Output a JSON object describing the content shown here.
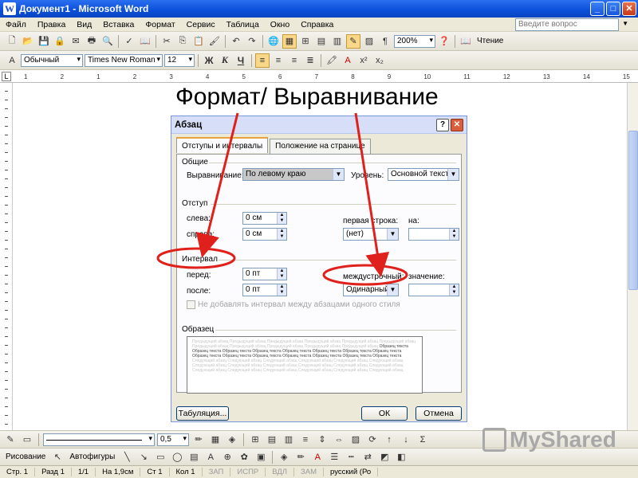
{
  "window": {
    "title": "Документ1 - Microsoft Word",
    "app_icon": "W"
  },
  "menu": {
    "items": [
      "Файл",
      "Правка",
      "Вид",
      "Вставка",
      "Формат",
      "Сервис",
      "Таблица",
      "Окно",
      "Справка"
    ],
    "help_placeholder": "Введите вопрос"
  },
  "standard_toolbar": {
    "zoom": "200%",
    "read_label": "Чтение"
  },
  "format_toolbar": {
    "style": "Обычный",
    "font": "Times New Roman",
    "size": "12",
    "bold": "Ж",
    "italic": "К",
    "underline": "Ч"
  },
  "ruler": {
    "marks": [
      "1",
      "2",
      "1",
      "2",
      "3",
      "4",
      "5",
      "6",
      "7",
      "8",
      "9",
      "10",
      "11",
      "12",
      "13",
      "14",
      "15"
    ]
  },
  "heading": "Формат/ Выравнивание",
  "dialog": {
    "title": "Абзац",
    "help_btn": "?",
    "close_btn": "✕",
    "tabs": [
      "Отступы и интервалы",
      "Положение на странице"
    ],
    "general": {
      "group": "Общие",
      "alignment_label": "Выравнивание:",
      "alignment_value": "По левому краю",
      "level_label": "Уровень:",
      "level_value": "Основной текст"
    },
    "indent": {
      "group": "Отступ",
      "left_label": "слева:",
      "left_value": "0 см",
      "right_label": "справа:",
      "right_value": "0 см",
      "first_line_label": "первая строка:",
      "first_line_value": "(нет)",
      "by_label": "на:",
      "by_value": ""
    },
    "spacing": {
      "group": "Интервал",
      "before_label": "перед:",
      "before_value": "0 пт",
      "after_label": "после:",
      "after_value": "0 пт",
      "line_label": "междустрочный:",
      "line_value": "Одинарный",
      "at_label": "значение:",
      "at_value": "",
      "no_space_label": "Не добавлять интервал между абзацами одного стиля"
    },
    "preview": {
      "group": "Образец",
      "prev_text": "Предыдущий абзац Предыдущий абзац Предыдущий абзац Предыдущий абзац Предыдущий абзац Предыдущий абзац Предыдущий абзац Предыдущий абзац Предыдущий абзац Предыдущий абзац Предыдущий абзац",
      "sample_text": "Образец текста Образец текста Образец текста Образец текста Образец текста Образец текста Образец текста Образец текста Образец текста Образец текста Образец текста Образец текста Образец текста Образец текста Образец текста",
      "next_text": "Следующий абзац Следующий абзац Следующий абзац Следующий абзац Следующий абзац Следующий абзац Следующий абзац Следующий абзац Следующий абзац Следующий абзац Следующий абзац Следующий абзац Следующий абзац Следующий абзац Следующий абзац Следующий абзац Следующий абзац Следующий абзац"
    },
    "tabs_btn": "Табуляция...",
    "ok": "ОК",
    "cancel": "Отмена"
  },
  "drawing_toolbar": {
    "draw_label": "Рисование",
    "autoshapes_label": "Автофигуры",
    "line_width": "0,5"
  },
  "status": {
    "page": "Стр. 1",
    "section": "Разд 1",
    "pages": "1/1",
    "at": "На 1,9см",
    "line": "Ст 1",
    "col": "Кол 1",
    "rec": "ЗАП",
    "trk": "ИСПР",
    "ext": "ВДЛ",
    "ovr": "ЗАМ",
    "lang": "русский (Ро"
  },
  "watermark": "MyShared",
  "colors": {
    "annotation": "#e0201b",
    "title_bar": "#0a4fd8"
  }
}
